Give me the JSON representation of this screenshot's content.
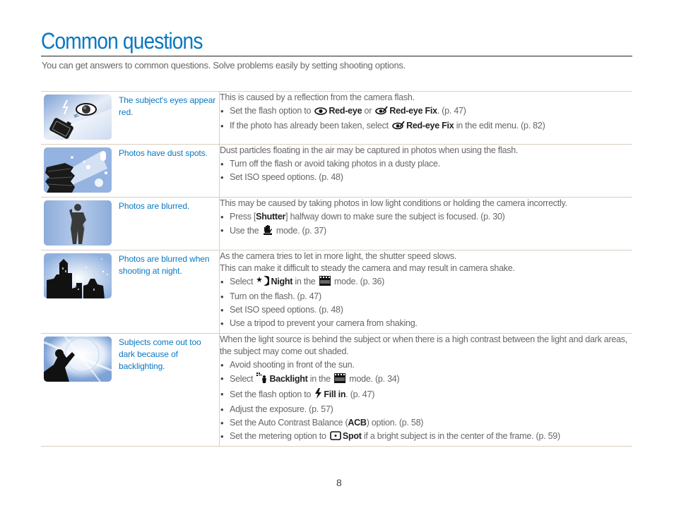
{
  "page": {
    "title": "Common questions",
    "subtitle": "You can get answers to common questions. Solve problems easily by setting shooting options.",
    "page_number": "8"
  },
  "colors": {
    "accent": "#0a78c2",
    "border": "#d8cfc0",
    "body_text": "#666666"
  },
  "rows": [
    {
      "image": "red-eye-illustration",
      "question": "The subject's eyes appear red.",
      "intro": "This is caused by a reflection from the camera flash.",
      "bullets": [
        {
          "pre": "Set the flash option to",
          "icon1": "red-eye-icon",
          "bold1": "Red-eye",
          "mid": "or",
          "icon2": "red-eye-fix-icon",
          "bold2": "Red-eye Fix",
          "post": ". (p. 47)"
        },
        {
          "pre": "If the photo has already been taken, select",
          "icon1": "red-eye-fix-icon",
          "bold1": "Red-eye Fix",
          "post": "in the edit menu. (p. 82)"
        }
      ]
    },
    {
      "image": "dust-spots-illustration",
      "question": "Photos have dust spots.",
      "intro": "Dust particles floating in the air may be captured in photos when using the flash.",
      "bullets": [
        {
          "text": "Turn off the flash or avoid taking photos in a dusty place."
        },
        {
          "text": "Set ISO speed options. (p. 48)"
        }
      ]
    },
    {
      "image": "blurred-photo-illustration",
      "question": "Photos are blurred.",
      "intro": "This may be caused by taking photos in low light conditions or holding the camera incorrectly.",
      "bullets": [
        {
          "pre": "Press [",
          "bold1": "Shutter",
          "post": "] halfway down to make sure the subject is focused. (p. 30)"
        },
        {
          "pre": "Use the",
          "icon1": "dual-is-mode-icon",
          "post": "mode. (p. 37)"
        }
      ]
    },
    {
      "image": "night-scene-illustration",
      "question": "Photos are blurred when shooting at night.",
      "intro": "As the camera tries to let in more light, the shutter speed slows.",
      "intro2": "This can make it difficult to steady the camera and may result in camera shake.",
      "bullets": [
        {
          "pre": "Select",
          "icon1": "night-icon",
          "bold1": "Night",
          "mid": "in the",
          "icon2": "scene-mode-icon",
          "post": "mode. (p. 36)"
        },
        {
          "text": "Turn on the flash. (p. 47)"
        },
        {
          "text": "Set ISO speed options. (p. 48)"
        },
        {
          "text": "Use a tripod to prevent your camera from shaking."
        }
      ]
    },
    {
      "image": "backlight-illustration",
      "question": "Subjects come out too dark because of backlighting.",
      "intro": "When the light source is behind the subject or when there is a high contrast between the light and dark areas, the subject may come out shaded.",
      "bullets": [
        {
          "text": "Avoid shooting in front of the sun."
        },
        {
          "pre": "Select",
          "icon1": "backlight-icon",
          "bold1": "Backlight",
          "mid": "in the",
          "icon2": "scene-mode-icon",
          "post": "mode. (p. 34)"
        },
        {
          "pre": "Set the flash option to",
          "icon1": "fill-in-flash-icon",
          "bold1": "Fill in",
          "post": ". (p. 47)"
        },
        {
          "text": "Adjust the exposure. (p. 57)"
        },
        {
          "pre": "Set the Auto Contrast Balance (",
          "bold1": "ACB",
          "post": ") option. (p. 58)"
        },
        {
          "pre": "Set the metering option to",
          "icon1": "spot-metering-icon",
          "bold1": "Spot",
          "post": "if a bright subject is in the center of the frame. (p. 59)"
        }
      ]
    }
  ]
}
